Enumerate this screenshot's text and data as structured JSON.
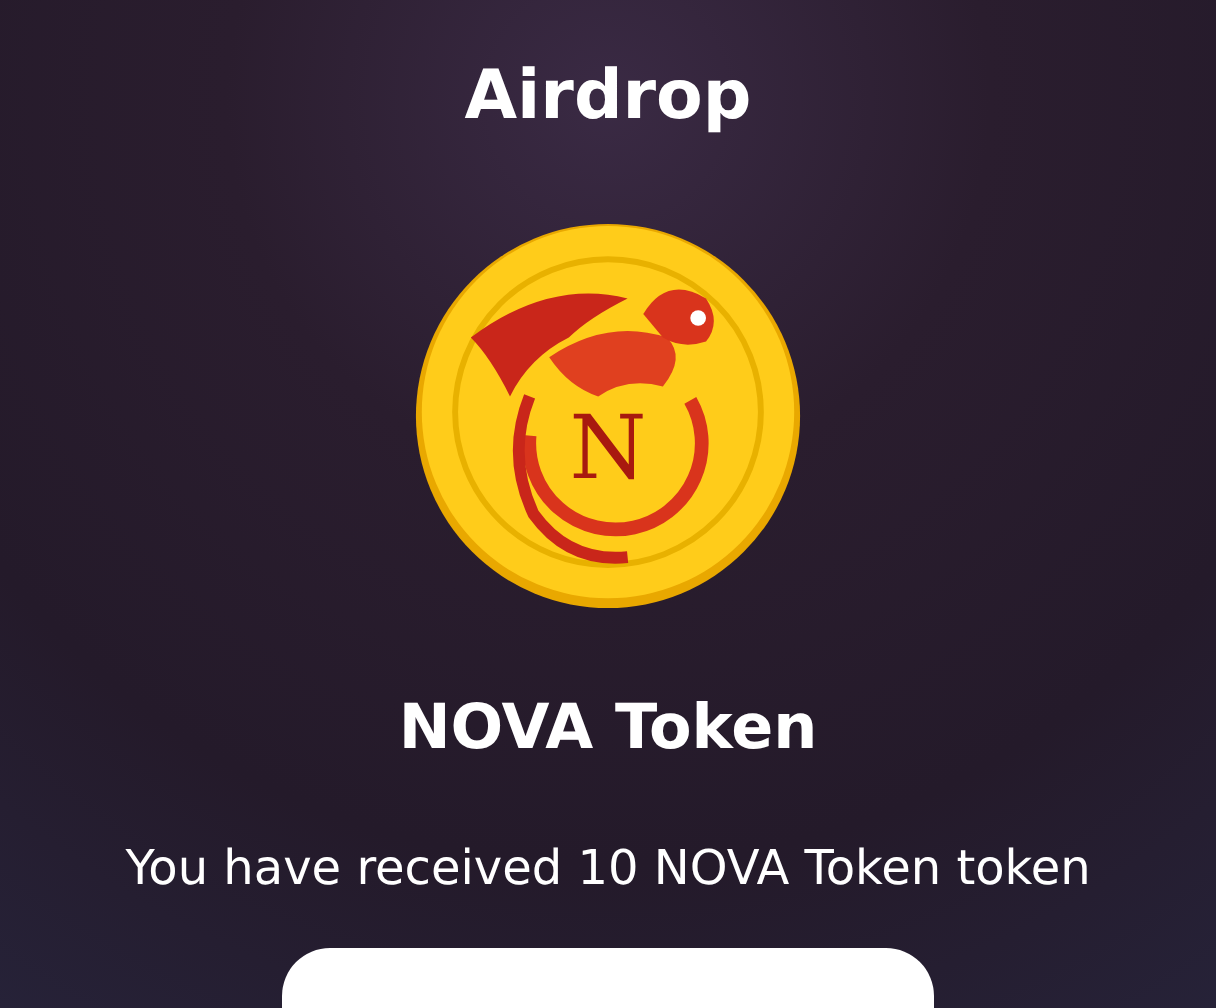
{
  "title": "Airdrop",
  "coin": {
    "letter": "N"
  },
  "token_name": "NOVA Token",
  "message": "You have received 10 NOVA Token token"
}
